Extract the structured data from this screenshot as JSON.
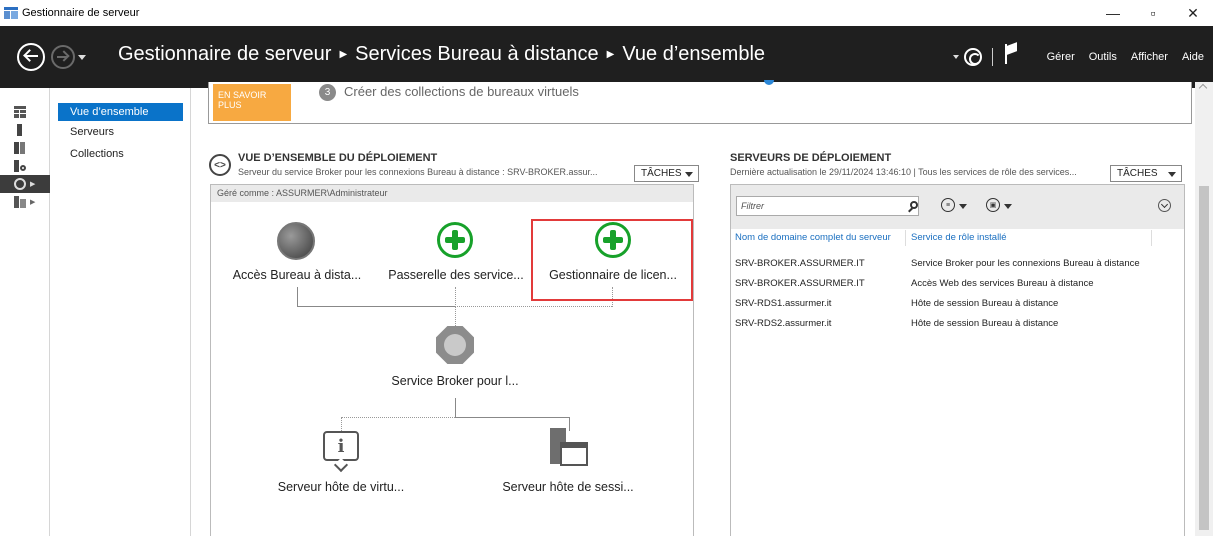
{
  "window": {
    "title": "Gestionnaire de serveur",
    "controls": [
      "—",
      "▫",
      "✕"
    ]
  },
  "header": {
    "breadcrumb": [
      "Gestionnaire de serveur",
      "Services Bureau à distance",
      "Vue d’ensemble"
    ],
    "menu": [
      "Gérer",
      "Outils",
      "Afficher",
      "Aide"
    ]
  },
  "rail": {
    "icons": [
      "dashboard-icon",
      "local-server-icon",
      "all-servers-icon",
      "file-storage-icon",
      "rds-icon",
      "group-icon"
    ]
  },
  "subnav": {
    "items": [
      "Vue d’ensemble",
      "Serveurs",
      "Collections"
    ],
    "active_index": 0
  },
  "banner": {
    "learn_more": "EN SAVOIR PLUS",
    "step_number": "3",
    "step_text": "Créer des collections de bureaux virtuels"
  },
  "deployment_overview": {
    "title": "VUE D’ENSEMBLE DU DÉPLOIEMENT",
    "subtitle": "Serveur du service Broker pour les connexions Bureau à distance : SRV-BROKER.assur...",
    "tasks_label": "TÂCHES",
    "managed_as": "Géré comme : ASSURMER\\Administrateur",
    "nodes": {
      "web_access": "Accès Bureau à dista...",
      "gateway": "Passerelle des service...",
      "licensing": "Gestionnaire de licen...",
      "broker": "Service Broker pour l...",
      "virtualization_host": "Serveur hôte de virtu...",
      "session_host": "Serveur hôte de sessi..."
    }
  },
  "deployment_servers": {
    "title": "SERVEURS DE DÉPLOIEMENT",
    "subtitle": "Dernière actualisation le 29/11/2024 13:46:10 | Tous les services de rôle des services...",
    "tasks_label": "TÂCHES",
    "filter_placeholder": "Filtrer",
    "columns": [
      "Nom de domaine complet du serveur",
      "Service de rôle installé"
    ],
    "rows": [
      [
        "SRV-BROKER.ASSURMER.IT",
        "Service Broker pour les connexions Bureau à distance"
      ],
      [
        "SRV-BROKER.ASSURMER.IT",
        "Accès Web des services Bureau à distance"
      ],
      [
        "SRV-RDS1.assurmer.it",
        "Hôte de session Bureau à distance"
      ],
      [
        "SRV-RDS2.assurmer.it",
        "Hôte de session Bureau à distance"
      ]
    ]
  },
  "colors": {
    "header_bg": "#1f1f1f",
    "accent_blue": "#0a73c9",
    "learn_more_orange": "#f7a941",
    "plus_green": "#17a12a",
    "highlight_red": "#e23a3a"
  }
}
